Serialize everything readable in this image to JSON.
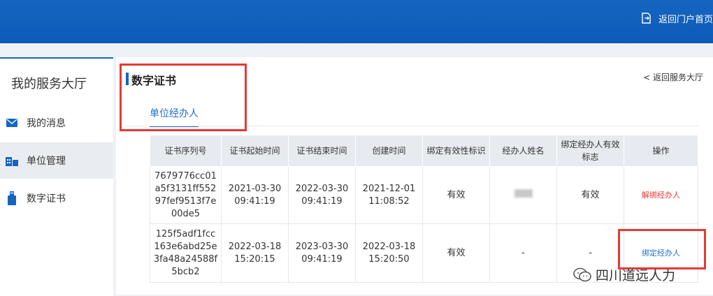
{
  "header": {
    "portal_link": "返回门户首页",
    "portal_icon": "exit-icon"
  },
  "sidebar": {
    "title": "我的服务大厅",
    "items": [
      {
        "label": "我的消息",
        "icon": "envelope-icon",
        "active": false
      },
      {
        "label": "单位管理",
        "icon": "building-icon",
        "active": true
      },
      {
        "label": "数字证书",
        "icon": "usb-key-icon",
        "active": false
      }
    ]
  },
  "main": {
    "title": "数字证书",
    "back_link": "< 返回服务大厅",
    "tabs": [
      {
        "label": "单位经办人",
        "active": true
      }
    ],
    "table": {
      "columns": [
        "证书序列号",
        "证书起始时间",
        "证书结束时间",
        "创建时间",
        "绑定有效性标识",
        "经办人姓名",
        "绑定经办人有效标志",
        "操作"
      ],
      "rows": [
        {
          "serial": "7679776cc01a5f3131ff55297fef9513f7e00de5",
          "start": "2021-03-30 09:41:19",
          "end": "2022-03-30 09:41:19",
          "created": "2021-12-01 11:08:52",
          "binding_valid": "有效",
          "agent_name": "",
          "agent_valid": "有效",
          "action": "解绑经办人"
        },
        {
          "serial": "125f5adf1fcc163e6abd25e3fa48a24588f5bcb2",
          "start": "2022-03-18 15:20:15",
          "end": "2023-03-30 09:41:19",
          "created": "2022-03-18 15:20:50",
          "binding_valid": "有效",
          "agent_name": "-",
          "agent_valid": "-",
          "action": "绑定经办人"
        }
      ]
    }
  },
  "watermark": {
    "text": "四川道远人力",
    "icon": "wechat-icon"
  },
  "colors": {
    "brand": "#1565c0",
    "highlight": "#e53935",
    "link_blue": "#1e6fd0",
    "link_red": "#e53935"
  }
}
